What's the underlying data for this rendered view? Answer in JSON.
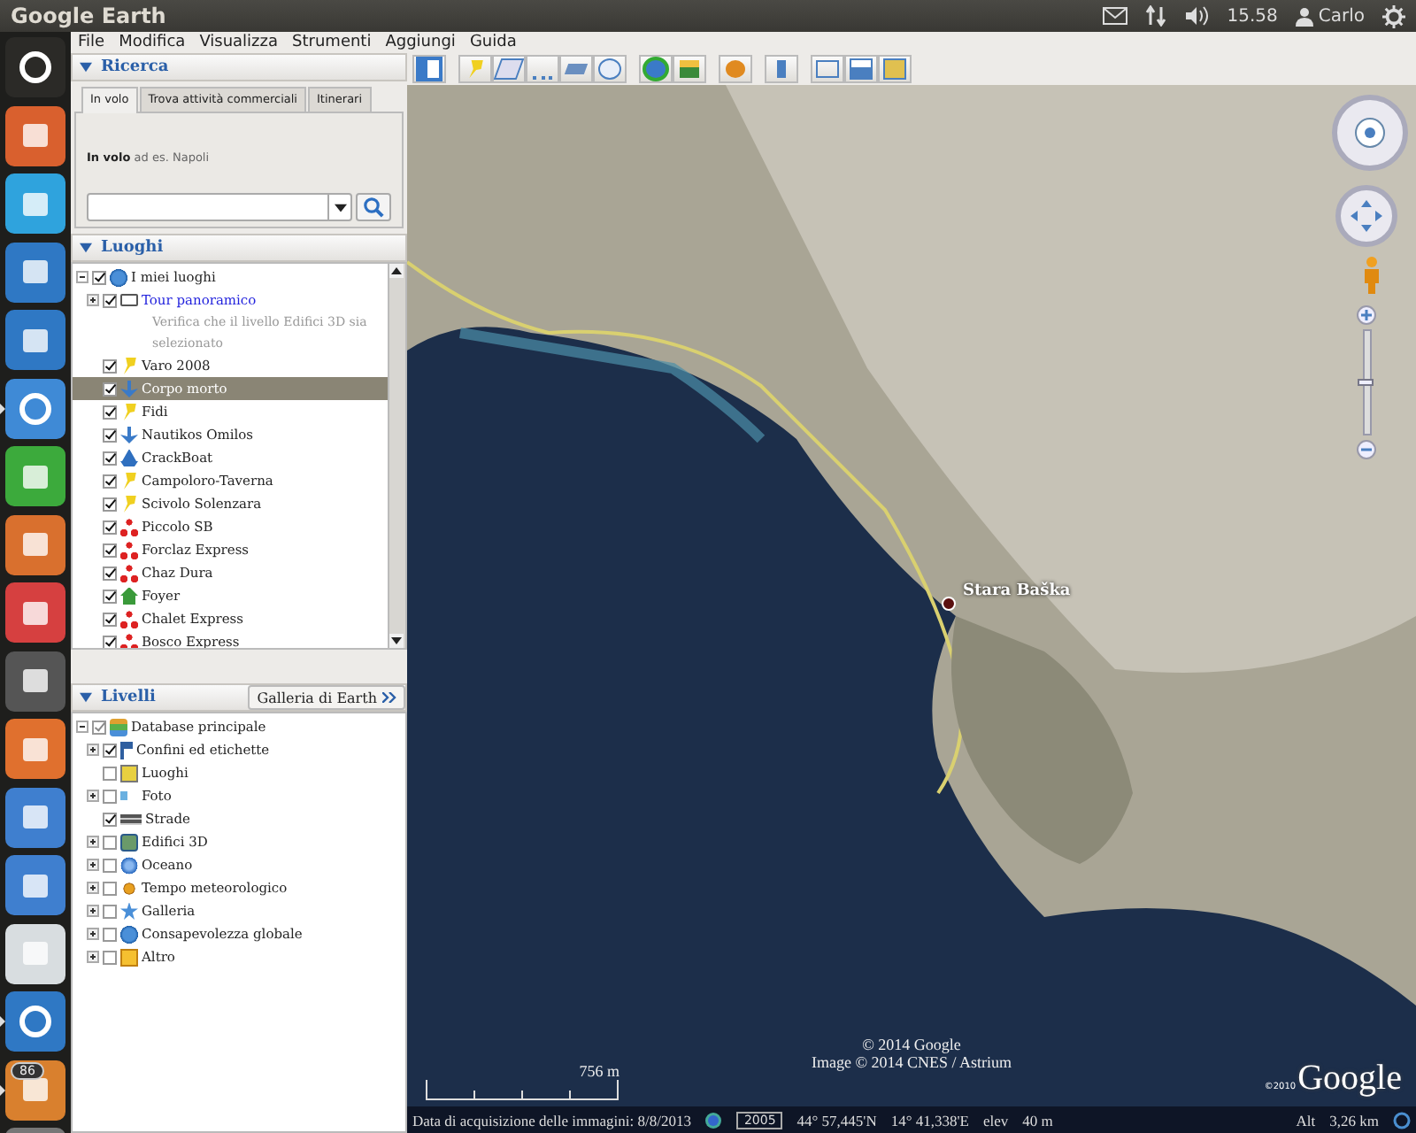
{
  "top_bar": {
    "title": "Google Earth",
    "time": "15.58",
    "user": "Carlo"
  },
  "launcher": [
    {
      "kind": "dash",
      "running": false
    },
    {
      "kind": "files",
      "running": false
    },
    {
      "kind": "skype",
      "running": false
    },
    {
      "kind": "office",
      "running": false
    },
    {
      "kind": "writer",
      "running": false
    },
    {
      "kind": "chrome",
      "running": true
    },
    {
      "kind": "calc",
      "running": false
    },
    {
      "kind": "impress",
      "running": false
    },
    {
      "kind": "settings",
      "running": false
    },
    {
      "kind": "terminal",
      "running": false
    },
    {
      "kind": "store",
      "running": false
    },
    {
      "kind": "photos",
      "running": false
    },
    {
      "kind": "mail",
      "running": false
    },
    {
      "kind": "music",
      "running": false
    },
    {
      "kind": "earth",
      "running": true
    },
    {
      "kind": "updates",
      "running": true,
      "badge": "86"
    },
    {
      "kind": "trash",
      "running": false
    }
  ],
  "menu": [
    "File",
    "Modifica",
    "Visualizza",
    "Strumenti",
    "Aggiungi",
    "Guida"
  ],
  "search": {
    "title": "Ricerca",
    "expanded": true,
    "tabs": [
      {
        "label": "In volo",
        "selected": true
      },
      {
        "label": "Trova attività commerciali",
        "selected": false
      },
      {
        "label": "Itinerari",
        "selected": false
      }
    ],
    "hint": "**In volo** ad es.  Napoli"
  },
  "places": {
    "title": "Luoghi",
    "expanded": true,
    "root": {
      "label": "I miei luoghi",
      "checked": true,
      "has_children": true,
      "expanded": true,
      "kind": "globe",
      "children": [
        {
          "label": "Tour panoramico",
          "kind": "folder",
          "checked": true,
          "has_children": true,
          "expanded": false,
          "link": true,
          "description": "Verifica che il livello Edifici 3D sia selezionato",
          "selected": false
        },
        {
          "label": "Varo 2008",
          "kind": "pin",
          "checked": true,
          "has_children": false,
          "selected": false
        },
        {
          "label": "Corpo morto",
          "kind": "anchor",
          "checked": true,
          "has_children": false,
          "selected": true
        },
        {
          "label": "Fidi",
          "kind": "pin",
          "checked": true,
          "has_children": false,
          "selected": false
        },
        {
          "label": "Nautikos Omilos",
          "kind": "anchor",
          "checked": true,
          "has_children": false,
          "selected": false
        },
        {
          "label": "CrackBoat",
          "kind": "boat",
          "checked": true,
          "has_children": false,
          "selected": false
        },
        {
          "label": "Campoloro-Taverna",
          "kind": "pin",
          "checked": true,
          "has_children": false,
          "selected": false
        },
        {
          "label": "Scivolo Solenzara",
          "kind": "pin",
          "checked": true,
          "has_children": false,
          "selected": false
        },
        {
          "label": "Piccolo SB",
          "kind": "dots",
          "checked": true,
          "has_children": false,
          "selected": false
        },
        {
          "label": "Forclaz Express",
          "kind": "dots",
          "checked": true,
          "has_children": false,
          "selected": false
        },
        {
          "label": "Chaz Dura",
          "kind": "dots",
          "checked": true,
          "has_children": false,
          "selected": false
        },
        {
          "label": "Foyer",
          "kind": "house",
          "checked": true,
          "has_children": false,
          "selected": false
        },
        {
          "label": "Chalet Express",
          "kind": "dots",
          "checked": true,
          "has_children": false,
          "selected": false
        },
        {
          "label": "Bosco Express",
          "kind": "dots",
          "checked": true,
          "has_children": false,
          "selected": false
        }
      ]
    }
  },
  "layers": {
    "title": "Livelli",
    "expanded": true,
    "gallery_button": "Galleria di Earth",
    "root": {
      "label": "Database principale",
      "checked": true,
      "has_children": true,
      "expanded": true,
      "kind": "stack",
      "children": [
        {
          "label": "Confini ed etichette",
          "kind": "flag",
          "checked": true,
          "has_children": true,
          "expanded": false
        },
        {
          "label": "Luoghi",
          "kind": "square",
          "checked": false,
          "has_children": false
        },
        {
          "label": "Foto",
          "kind": "photo",
          "checked": false,
          "has_children": true,
          "expanded": false
        },
        {
          "label": "Strade",
          "kind": "road",
          "checked": true,
          "has_children": false
        },
        {
          "label": "Edifici 3D",
          "kind": "building",
          "checked": false,
          "has_children": true,
          "expanded": false
        },
        {
          "label": "Oceano",
          "kind": "ball",
          "checked": false,
          "has_children": true,
          "expanded": false
        },
        {
          "label": "Tempo meteorologico",
          "kind": "sun",
          "checked": false,
          "has_children": true,
          "expanded": false
        },
        {
          "label": "Galleria",
          "kind": "star",
          "checked": false,
          "has_children": true,
          "expanded": false
        },
        {
          "label": "Consapevolezza globale",
          "kind": "globe",
          "checked": false,
          "has_children": true,
          "expanded": false
        },
        {
          "label": "Altro",
          "kind": "note",
          "checked": false,
          "has_children": true,
          "expanded": false
        }
      ]
    }
  },
  "toolbar": [
    [
      {
        "kind": "sidebar"
      }
    ],
    [
      {
        "kind": "placemark"
      },
      {
        "kind": "polygon"
      },
      {
        "kind": "path"
      },
      {
        "kind": "overlay"
      },
      {
        "kind": "tour"
      }
    ],
    [
      {
        "kind": "history"
      },
      {
        "kind": "sun"
      }
    ],
    [
      {
        "kind": "planet"
      }
    ],
    [
      {
        "kind": "ruler"
      }
    ],
    [
      {
        "kind": "email"
      },
      {
        "kind": "print"
      },
      {
        "kind": "map"
      }
    ]
  ],
  "map": {
    "place_label": "Stara Baška",
    "copyright": [
      "© 2014 Google",
      "Image © 2014 CNES / Astrium"
    ],
    "scale": "756 m",
    "logo_year": "©2010",
    "logo": "Google",
    "zoom": {
      "level": 0.5
    }
  },
  "status_bar": {
    "acquisition": "Data di acquisizione delle immagini: 8/8/2013",
    "year": "2005",
    "lat": "44° 57,445'N",
    "lon": "14° 41,338'E",
    "elev_label": "elev",
    "elev": "40 m",
    "alt_label": "Alt",
    "alt": "3,26 km"
  }
}
